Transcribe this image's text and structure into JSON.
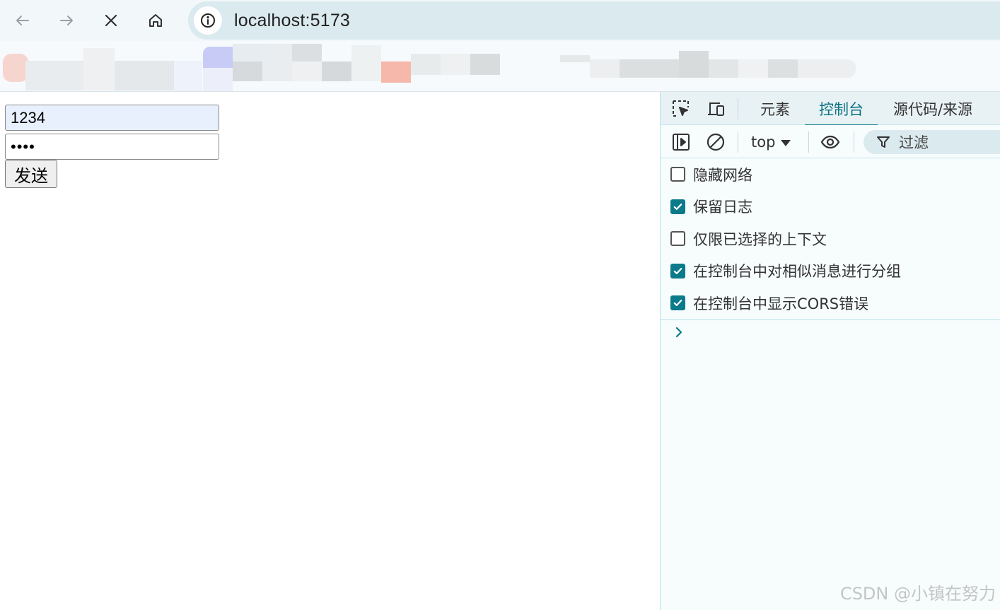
{
  "browser": {
    "url": "localhost:5173",
    "nav": {
      "back_icon": "arrow-left-icon",
      "forward_icon": "arrow-right-icon",
      "stop_icon": "close-icon",
      "home_icon": "home-icon",
      "info_icon": "info-icon"
    }
  },
  "page": {
    "username_value": "1234",
    "password_value": "••••",
    "send_label": "发送"
  },
  "devtools": {
    "tabs": [
      {
        "label": "元素",
        "active": false
      },
      {
        "label": "控制台",
        "active": true
      },
      {
        "label": "源代码/来源",
        "active": false
      }
    ],
    "context": "top",
    "filter_placeholder": "过滤",
    "settings": [
      {
        "label": "隐藏网络",
        "checked": false
      },
      {
        "label": "保留日志",
        "checked": true
      },
      {
        "label": "仅限已选择的上下文",
        "checked": false
      },
      {
        "label": "在控制台中对相似消息进行分组",
        "checked": true
      },
      {
        "label": "在控制台中显示CORS错误",
        "checked": true
      }
    ],
    "accent_color": "#0b7a8a"
  },
  "watermark": "CSDN @小镇在努力"
}
